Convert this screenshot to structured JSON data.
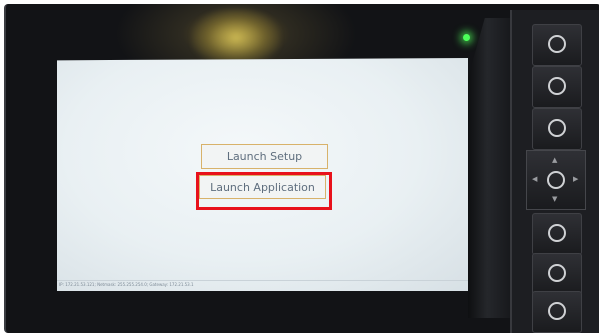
{
  "screen": {
    "buttons": {
      "launch_setup": "Launch Setup",
      "launch_application": "Launch Application"
    },
    "status_bar": "IP: 172.21.53.121; Netmask: 255.255.254.0; Gateway: 172.21.53.1"
  },
  "annotation": {
    "highlight_color": "#e8111b",
    "highlighted_target": "launch_application"
  },
  "device": {
    "status_led_color": "#4cff5a",
    "keypad": {
      "key_icons": [
        "circle-icon",
        "circle-icon",
        "circle-icon",
        "circle-icon",
        "circle-icon",
        "circle-icon"
      ],
      "nav_arrows": [
        "▲",
        "▼",
        "◀",
        "▶"
      ]
    }
  }
}
